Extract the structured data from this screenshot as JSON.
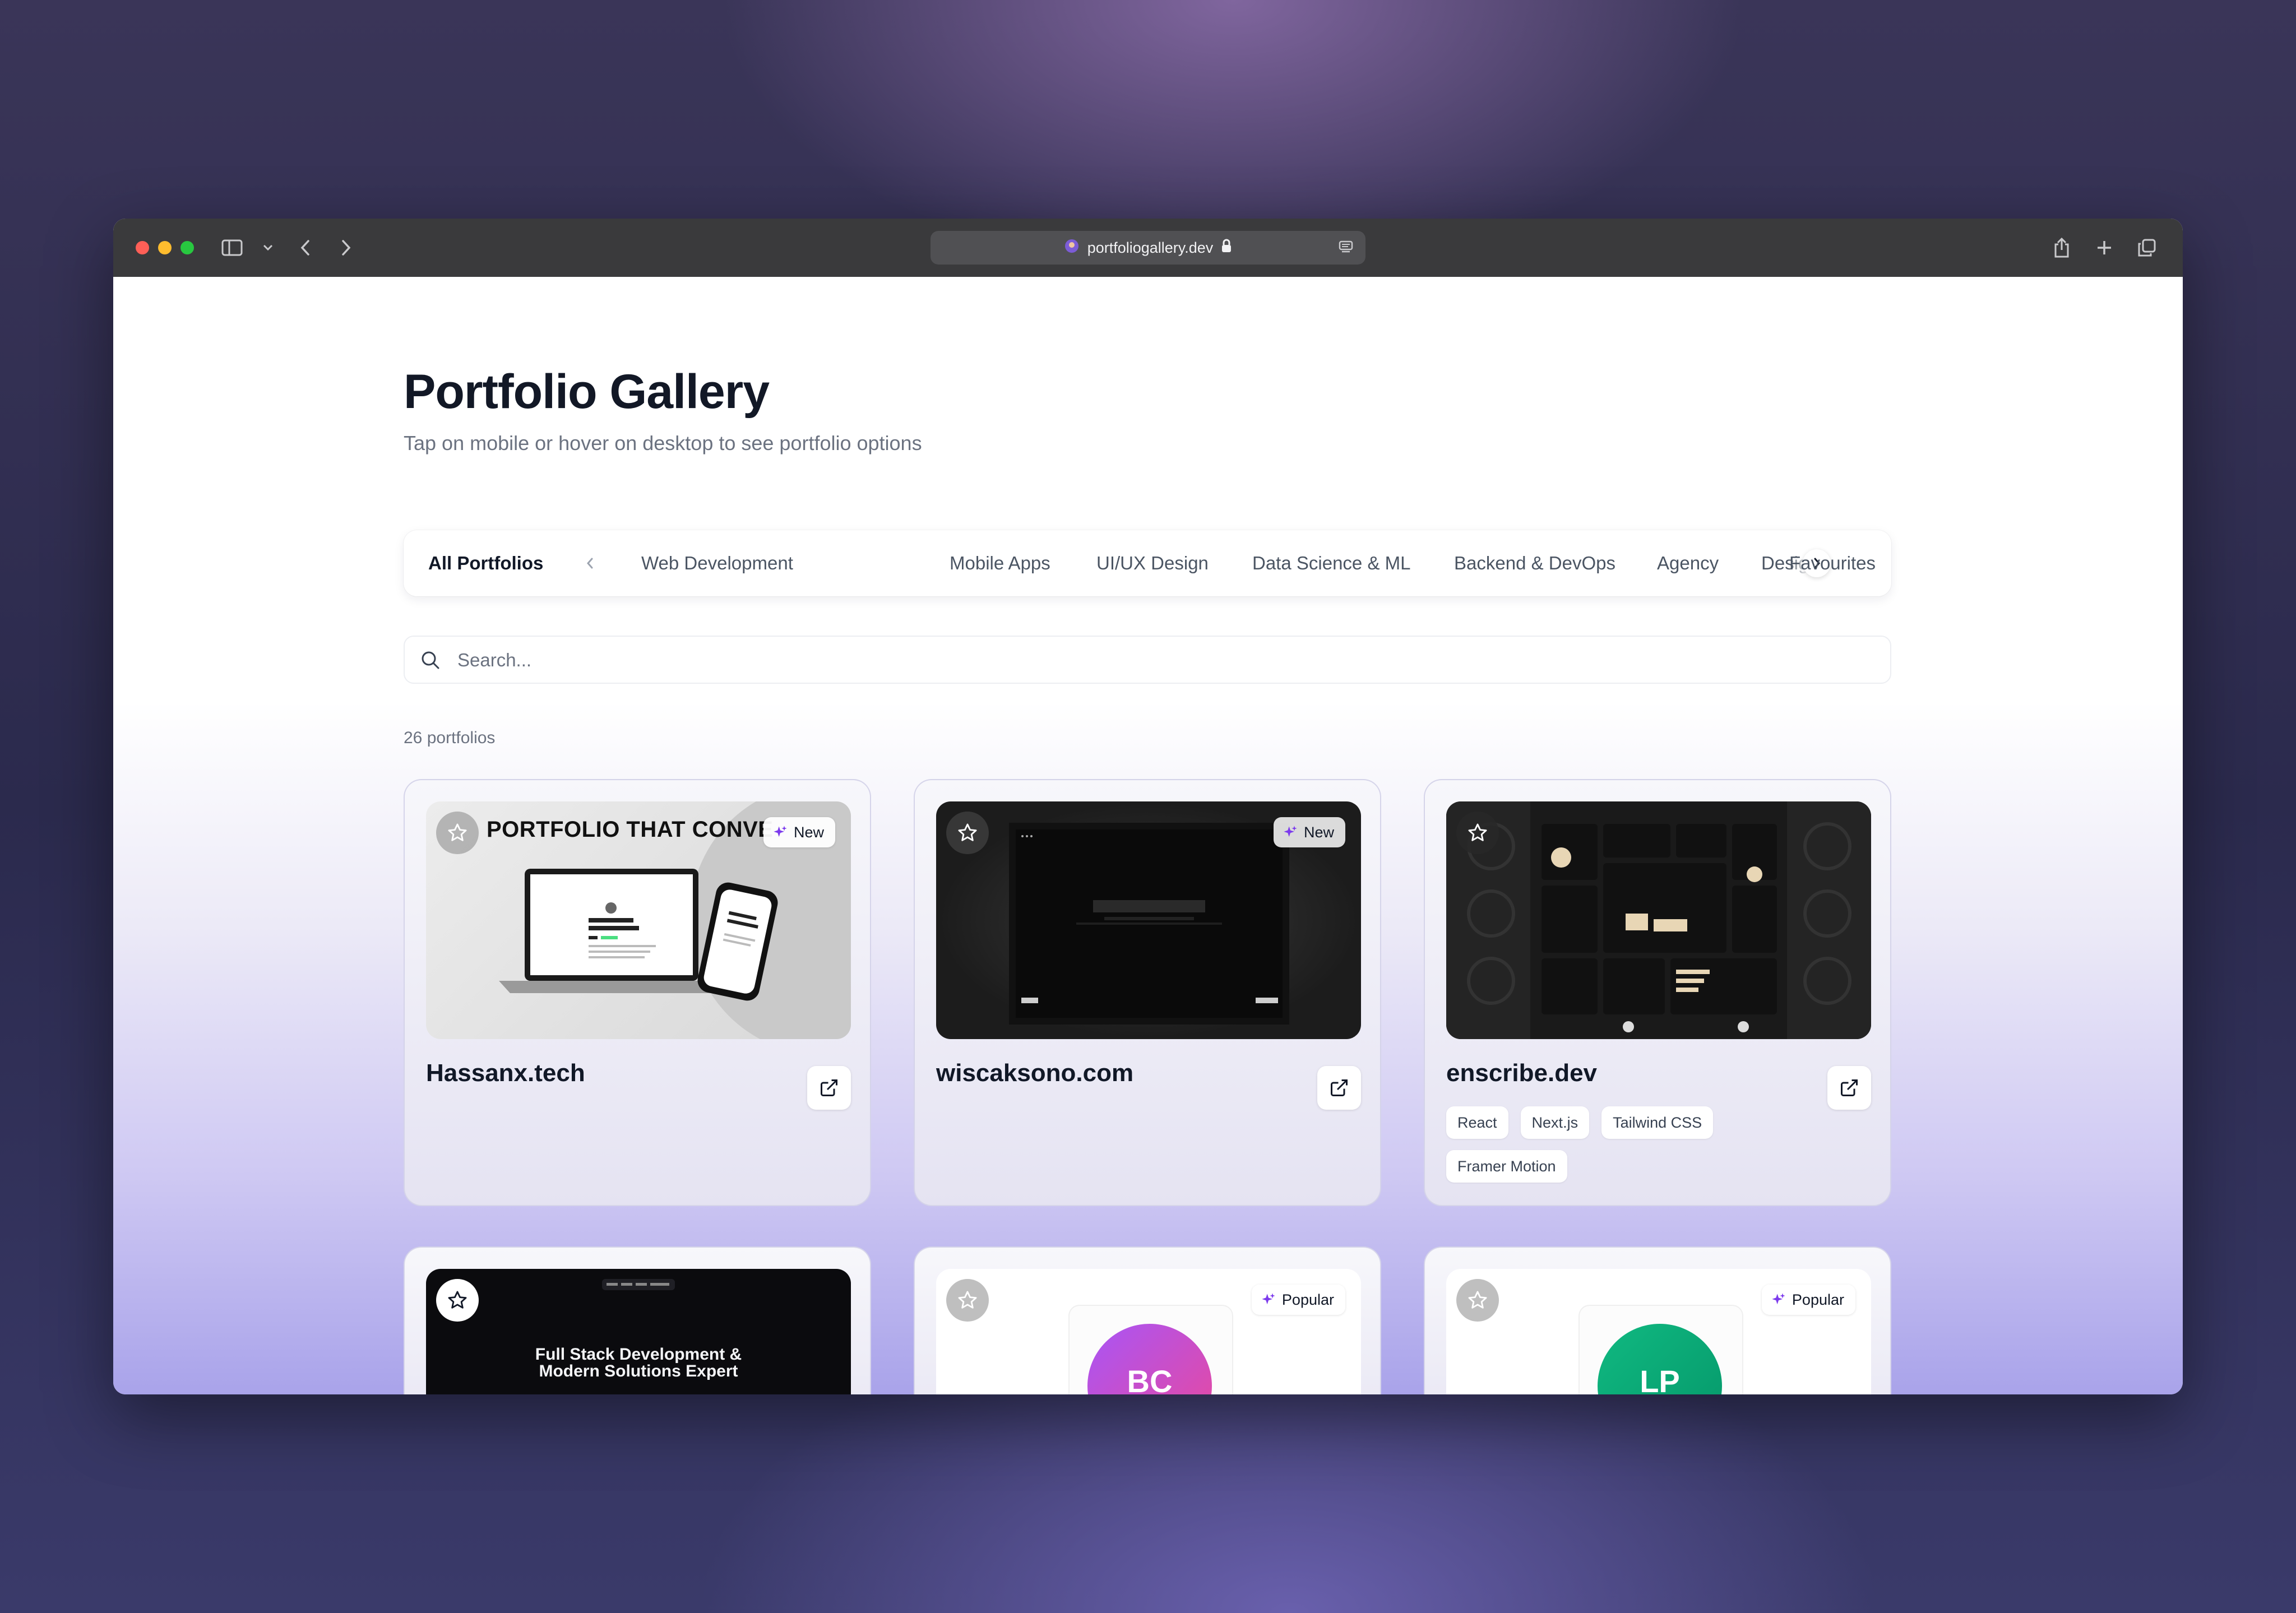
{
  "browser": {
    "url": "portfoliogallery.dev"
  },
  "header": {
    "title": "Portfolio Gallery",
    "subtitle": "Tap on mobile or hover on desktop to see portfolio options"
  },
  "tabs": [
    {
      "label": "All Portfolios",
      "active": true
    },
    {
      "label": "Web Development"
    },
    {
      "label": "Mobile Apps"
    },
    {
      "label": "UI/UX Design"
    },
    {
      "label": "Data Science & ML"
    },
    {
      "label": "Backend & DevOps"
    },
    {
      "label": "Agency"
    },
    {
      "label": "Desig"
    },
    {
      "label": "Favourites"
    }
  ],
  "search": {
    "placeholder": "Search..."
  },
  "count_text": "26 portfolios",
  "cards": [
    {
      "title": "Hassanx.tech",
      "badge": "New",
      "thumb_text": "PORTFOLIO THAT CONVE",
      "tags": []
    },
    {
      "title": "wiscaksono.com",
      "badge": "New",
      "tags": []
    },
    {
      "title": "enscribe.dev",
      "tags": [
        "React",
        "Next.js",
        "Tailwind CSS",
        "Framer Motion"
      ]
    },
    {
      "thumb_text_1": "Full Stack Development &",
      "thumb_text_2": "Modern Solutions Expert"
    },
    {
      "badge": "Popular",
      "initials": "BC"
    },
    {
      "badge": "Popular",
      "initials": "LP"
    }
  ],
  "colors": {
    "accent": "#7c3aed",
    "traffic_red": "#ff5f57",
    "traffic_yellow": "#febc2e",
    "traffic_green": "#28c840"
  }
}
